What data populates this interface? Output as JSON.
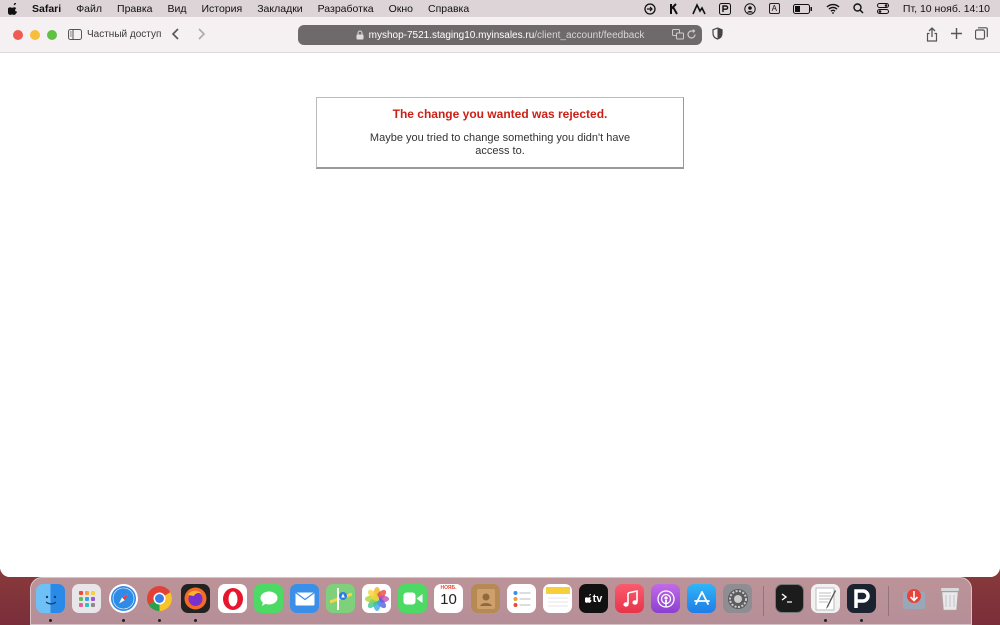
{
  "menubar": {
    "app_name": "Safari",
    "items": [
      "Файл",
      "Правка",
      "Вид",
      "История",
      "Закладки",
      "Разработка",
      "Окно",
      "Справка"
    ],
    "input_indicator": "A",
    "clock": "Пт, 10 нояб.  14:10"
  },
  "toolbar": {
    "private_label": "Частный доступ",
    "url_host": "myshop-7521.staging10.myinsales.ru",
    "url_path": "/client_account/feedback"
  },
  "page": {
    "error_title": "The change you wanted was rejected.",
    "error_message": "Maybe you tried to change something you didn't have access to."
  },
  "dock": {
    "calendar_month": "НОЯБ.",
    "calendar_day": "10",
    "tv_label": "tv",
    "apps": [
      "finder",
      "launchpad",
      "safari",
      "chrome",
      "firefox",
      "opera",
      "messages",
      "mail",
      "maps",
      "photos",
      "facetime",
      "calendar",
      "contacts",
      "reminders",
      "notes",
      "apple-tv",
      "music",
      "podcasts",
      "app-store",
      "system-preferences",
      "terminal",
      "textedit",
      "pockity",
      "downloads",
      "trash"
    ]
  },
  "colors": {
    "error_red": "#cc1f15",
    "window_close": "#ee5b53",
    "window_minimize": "#f6be3b",
    "window_zoom": "#5fc143"
  }
}
